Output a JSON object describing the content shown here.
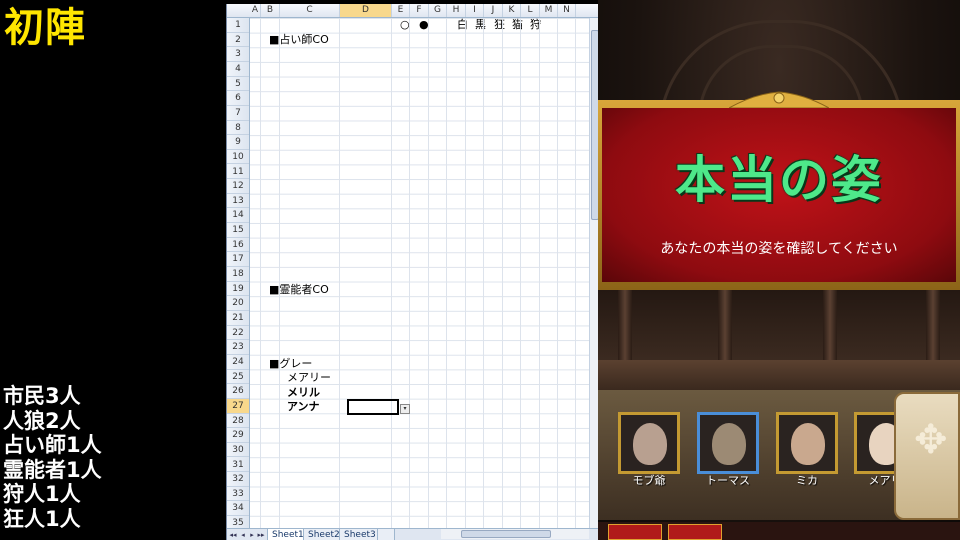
{
  "overlay": {
    "title": "初陣",
    "roles": [
      "市民3人",
      "人狼2人",
      "占い師1人",
      "霊能者1人",
      "狩人1人",
      "狂人1人"
    ]
  },
  "spreadsheet": {
    "columns": [
      "A",
      "B",
      "C",
      "D",
      "E",
      "F",
      "G",
      "H",
      "I",
      "J",
      "K",
      "L",
      "M",
      "N"
    ],
    "selected_column": "D",
    "rows": [
      "1",
      "2",
      "3",
      "4",
      "5",
      "6",
      "7",
      "8",
      "9",
      "10",
      "11",
      "12",
      "13",
      "14",
      "15",
      "16",
      "17",
      "18",
      "19",
      "20",
      "21",
      "22",
      "23",
      "24",
      "25",
      "26",
      "27",
      "28",
      "29",
      "30",
      "31",
      "32",
      "33",
      "34",
      "35"
    ],
    "selected_row": "27",
    "header_marks": {
      "white": "○",
      "black": "●"
    },
    "role_headers": [
      "白",
      "黒",
      "狂",
      "猫",
      "狩"
    ],
    "seer_header": "■占い師CO",
    "medium_header": "■霊能者CO",
    "gray_header": "■グレー",
    "gray_names": [
      "メアリー",
      "メリル",
      "アンナ"
    ],
    "dropdown_glyph": "▾",
    "sheet_tabs": [
      "Sheet1",
      "Sheet2",
      "Sheet3"
    ],
    "nav_glyphs": [
      "◂◂",
      "◂",
      "▸",
      "▸▸"
    ]
  },
  "game": {
    "banner_title": "本当の姿",
    "banner_subtitle": "あなたの本当の姿を確認してください",
    "characters": [
      {
        "name": "モブ爺",
        "selected": false
      },
      {
        "name": "トーマス",
        "selected": true
      },
      {
        "name": "ミカ",
        "selected": false
      },
      {
        "name": "メアリ",
        "selected": false
      }
    ],
    "ornament_glyph": "✥"
  },
  "colors": {
    "title_yellow": "#ffe600",
    "banner_red": "#c01218",
    "banner_text_green": "#4ee88a",
    "frame_gold": "#c49a32",
    "selected_blue": "#4a8ed8"
  }
}
